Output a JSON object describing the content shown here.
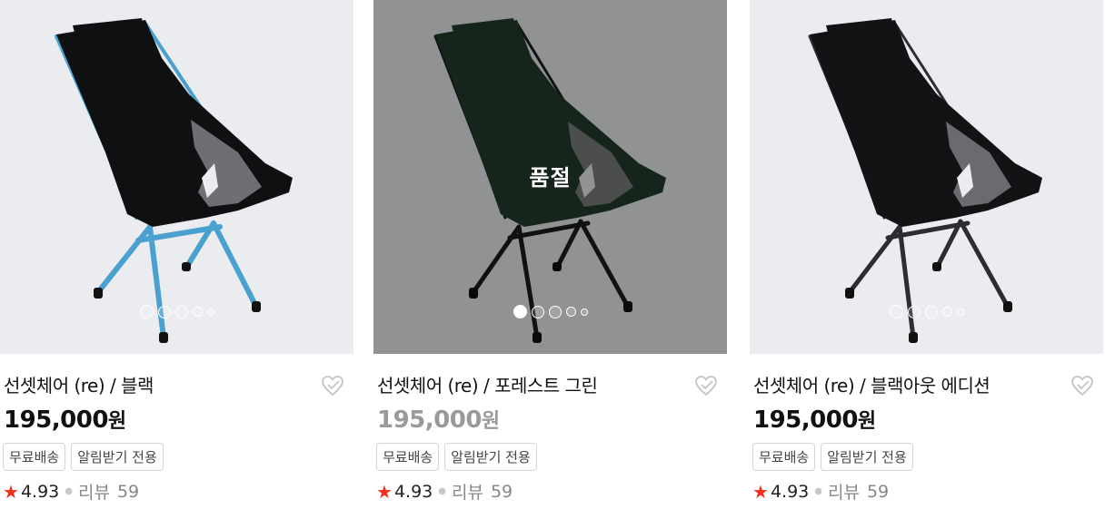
{
  "products": [
    {
      "name": "선셋체어 (re) / 블랙",
      "price": "195,000",
      "currency": "원",
      "sold_out": false,
      "tags": [
        "무료배송",
        "알림받기 전용"
      ],
      "rating": "4.93",
      "review_label": "리뷰",
      "review_count": "59",
      "image": {
        "frame_color": "#4aa0cf",
        "fabric_color": "#0f1012",
        "active_dot": -1
      }
    },
    {
      "name": "선셋체어 (re) / 포레스트 그린",
      "price": "195,000",
      "currency": "원",
      "sold_out": true,
      "sold_out_label": "품절",
      "tags": [
        "무료배송",
        "알림받기 전용"
      ],
      "rating": "4.93",
      "review_label": "리뷰",
      "review_count": "59",
      "image": {
        "frame_color": "#1b1c1e",
        "fabric_color": "#223d2c",
        "active_dot": 0
      }
    },
    {
      "name": "선셋체어 (re) / 블랙아웃 에디션",
      "price": "195,000",
      "currency": "원",
      "sold_out": false,
      "tags": [
        "무료배송",
        "알림받기 전용"
      ],
      "rating": "4.93",
      "review_label": "리뷰",
      "review_count": "59",
      "image": {
        "frame_color": "#2c2d30",
        "fabric_color": "#121315",
        "active_dot": -1
      }
    }
  ],
  "colors": {
    "image_bg": "#eaecef",
    "star": "#f0311c",
    "muted_price": "#9a9a9a",
    "tag_border": "#d4d4d4"
  },
  "icons": {
    "wishlist": "heart-outline-icon",
    "rating": "star-icon"
  }
}
